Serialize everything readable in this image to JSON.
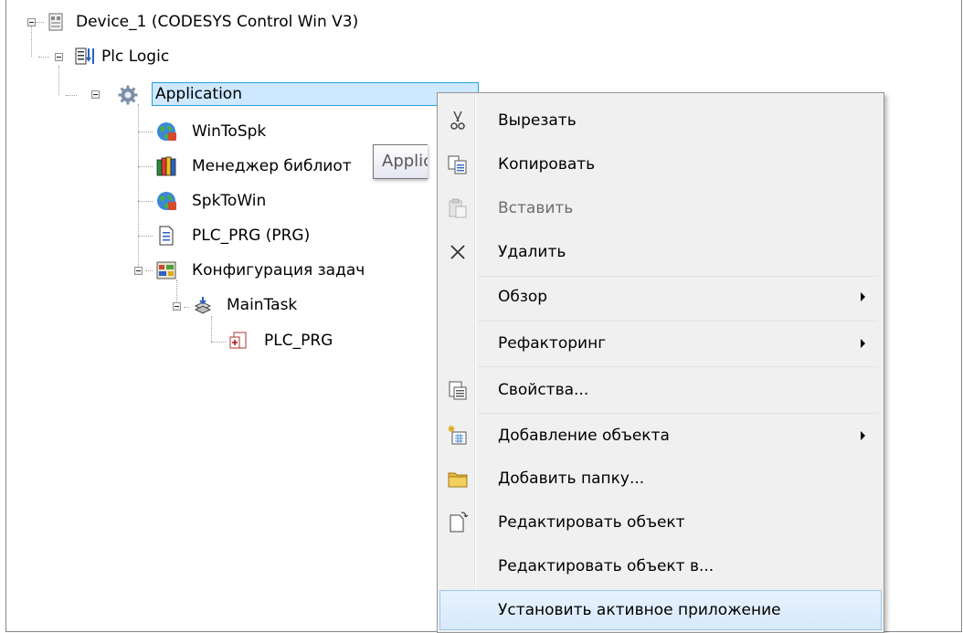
{
  "tree": {
    "device": {
      "label": "Device_1 (CODESYS Control Win V3)",
      "icon": "device-icon"
    },
    "plc_logic": {
      "label": "Plc Logic",
      "icon": "plc-logic-icon"
    },
    "application": {
      "label": "Application",
      "icon": "gear-icon"
    },
    "wintospk": {
      "label": "WinToSpk",
      "icon": "globe-icon"
    },
    "library_manager": {
      "label": "Менеджер библиот",
      "icon": "library-books-icon"
    },
    "spktowin": {
      "label": "SpkToWin",
      "icon": "globe-icon"
    },
    "plc_prg": {
      "label": "PLC_PRG (PRG)",
      "icon": "document-icon"
    },
    "task_config": {
      "label": "Конфигурация задач",
      "icon": "task-config-icon"
    },
    "maintask": {
      "label": "MainTask",
      "icon": "task-icon"
    },
    "task_plc_prg": {
      "label": "PLC_PRG",
      "icon": "program-call-icon"
    }
  },
  "tooltip": {
    "text": "Application"
  },
  "context_menu": {
    "items": [
      {
        "label": "Вырезать",
        "icon": "scissors-icon",
        "enabled": true
      },
      {
        "label": "Копировать",
        "icon": "copy-icon",
        "enabled": true
      },
      {
        "label": "Вставить",
        "icon": "paste-icon",
        "enabled": false
      },
      {
        "label": "Удалить",
        "icon": "delete-x-icon",
        "enabled": true
      },
      {
        "label": "Обзор",
        "submenu": true,
        "enabled": true
      },
      {
        "label": "Рефакторинг",
        "submenu": true,
        "enabled": true
      },
      {
        "label": "Свойства...",
        "icon": "properties-icon",
        "enabled": true
      },
      {
        "label": "Добавление объекта",
        "icon": "add-object-icon",
        "submenu": true,
        "enabled": true
      },
      {
        "label": "Добавить папку...",
        "icon": "folder-icon",
        "enabled": true
      },
      {
        "label": "Редактировать объект",
        "icon": "edit-document-icon",
        "enabled": true
      },
      {
        "label": "Редактировать объект в...",
        "enabled": true
      },
      {
        "label": "Установить активное приложение",
        "enabled": true,
        "highlighted": true
      }
    ]
  }
}
